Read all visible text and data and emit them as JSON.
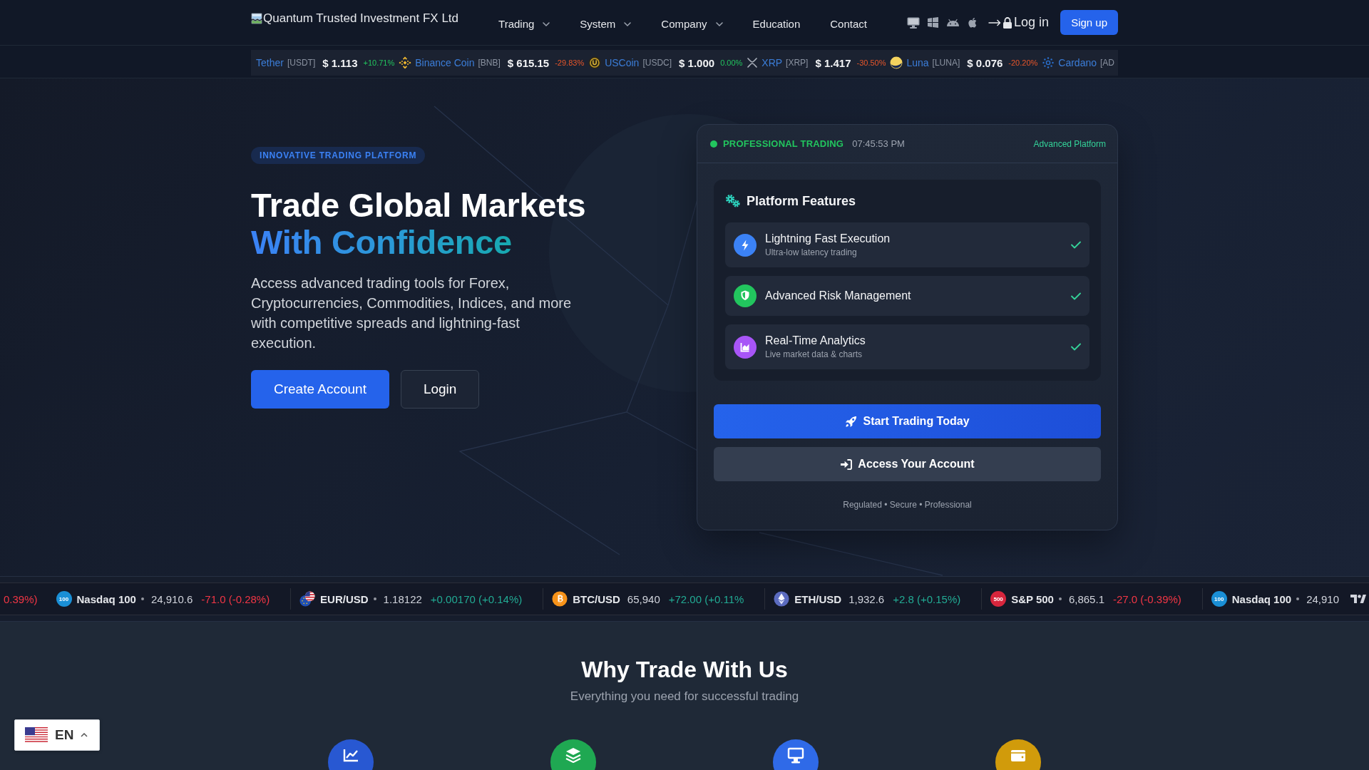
{
  "header": {
    "logo_text": "Quantum Trusted Investment FX Ltd",
    "nav": [
      {
        "label": "Trading",
        "dropdown": true
      },
      {
        "label": "System",
        "dropdown": true
      },
      {
        "label": "Company",
        "dropdown": true
      },
      {
        "label": "Education",
        "dropdown": false
      },
      {
        "label": "Contact",
        "dropdown": false
      }
    ],
    "login": "Log in",
    "signup": "Sign up"
  },
  "crypto_ticker": [
    {
      "name": "Tether",
      "symbol": "[USDT]",
      "price": "$ 1.113",
      "change": "+10.71%",
      "rising": true
    },
    {
      "name": "Binance Coin",
      "symbol": "[BNB]",
      "price": "$ 615.15",
      "change": "-29.83%",
      "rising": false
    },
    {
      "name": "USCoin",
      "symbol": "[USDC]",
      "price": "$ 1.000",
      "change": "0.00%",
      "rising": true
    },
    {
      "name": "XRP",
      "symbol": "[XRP]",
      "price": "$ 1.417",
      "change": "-30.50%",
      "rising": false
    },
    {
      "name": "Luna",
      "symbol": "[LUNA]",
      "price": "$ 0.076",
      "change": "-20.20%",
      "rising": false
    },
    {
      "name": "Cardano",
      "symbol": "[AD"
    }
  ],
  "hero": {
    "badge": "INNOVATIVE TRADING PLATFORM",
    "title": "Trade Global Markets",
    "highlight": "With Confidence",
    "description": "Access advanced trading tools for Forex, Cryptocurrencies, Commodities, Indices, and more with competitive spreads and lightning-fast execution.",
    "buttons": [
      {
        "label": "Create Account",
        "kind": "primary"
      },
      {
        "label": "Login",
        "kind": "secondary"
      }
    ]
  },
  "platform_card": {
    "live": true,
    "status": "PROFESSIONAL TRADING",
    "time": "07:45:53 PM",
    "tag": "Advanced Platform",
    "features_title": "Platform Features",
    "features": [
      {
        "title": "Lightning Fast Execution",
        "subtitle": "Ultra-low latency trading",
        "color": "#3b82f6",
        "checked": true
      },
      {
        "title": "Advanced Risk Management",
        "color": "#22c55e",
        "checked": true
      },
      {
        "title": "Real-Time Analytics",
        "subtitle": "Live market data & charts",
        "color": "#a855f7",
        "checked": true
      }
    ],
    "buttons": [
      {
        "label": "Start Trading Today",
        "kind": "primary"
      },
      {
        "label": "Access Your Account",
        "kind": "secondary"
      }
    ],
    "footnote": "Regulated • Secure • Professional"
  },
  "market_ticker": [
    {
      "kind": "fragment",
      "change": "0.39%)",
      "rising": false
    },
    {
      "kind": "badge",
      "badge": "100",
      "color": "#1a8fd6",
      "name": "Nasdaq 100",
      "closed": true,
      "price": "24,910.6",
      "change": "-71.0 (-0.28%)",
      "rising": false
    },
    {
      "kind": "flags",
      "name": "EUR/USD",
      "closed": true,
      "price": "1.18122",
      "change": "+0.00170 (+0.14%)",
      "rising": true
    },
    {
      "kind": "bitcoin",
      "name": "BTC/USD",
      "closed": false,
      "price": "65,940",
      "change": "+72.00 (+0.11%",
      "rising": true
    },
    {
      "kind": "ether",
      "name": "ETH/USD",
      "closed": false,
      "price": "1,932.6",
      "change": "+2.8 (+0.15%)",
      "rising": true
    },
    {
      "kind": "badge",
      "badge": "500",
      "color": "#d7263d",
      "name": "S&P 500",
      "closed": true,
      "price": "6,865.1",
      "change": "-27.0 (-0.39%)",
      "rising": false
    },
    {
      "kind": "badge",
      "badge": "100",
      "color": "#1a8fd6",
      "name": "Nasdaq 100",
      "closed": true,
      "price": "24,910"
    }
  ],
  "why_section": {
    "title": "Why Trade With Us",
    "subtitle": "Everything you need for successful trading",
    "features": [
      {
        "color": "#2858d2"
      },
      {
        "color": "#1fa852"
      },
      {
        "color": "#2f6ae8"
      },
      {
        "color": "#d19b0b"
      }
    ]
  },
  "language": {
    "code": "EN"
  }
}
